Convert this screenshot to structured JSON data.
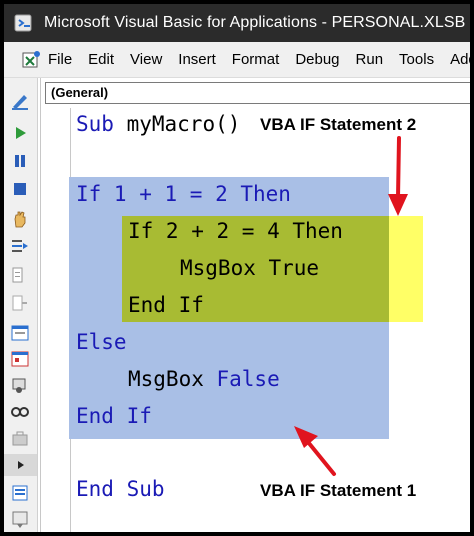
{
  "window": {
    "title": "Microsoft Visual Basic for Applications - PERSONAL.XLSB - [Module"
  },
  "menu": [
    "File",
    "Edit",
    "View",
    "Insert",
    "Format",
    "Debug",
    "Run",
    "Tools",
    "Add-I"
  ],
  "toolbar_icons": [
    "design-mode-icon",
    "run-icon",
    "pause-icon",
    "stop-icon",
    "hand-icon",
    "step-into-icon",
    "step-over-icon",
    "step-out-icon",
    "userform-icon",
    "properties-icon",
    "object-browser-icon",
    "watch-icon",
    "toolbox-icon",
    "expand-icon",
    "module-icon",
    "project-icon"
  ],
  "code_window": {
    "object_combo": "(General)",
    "lines": {
      "sub_keyword": "Sub",
      "sub_name": " myMacro()",
      "if1": "If 1 + 1 = 2 Then",
      "if2": "If 2 + 2 = 4 Then",
      "msgbox1_fn": "MsgBox",
      "msgbox1_val": " True",
      "endif2": "End If",
      "else": "Else",
      "msgbox2_fn": "MsgBox",
      "msgbox2_val": " False",
      "endif1": "End If",
      "endsub": "End Sub"
    }
  },
  "annotations": {
    "stmt2": "VBA IF Statement 2",
    "stmt1": "VBA IF Statement 1"
  },
  "colors": {
    "keyword": "#1a1ab5",
    "highlight_outer": "#a9bfe6",
    "highlight_inner": "#a8bb33",
    "highlight_yellow": "#ffff66",
    "arrow": "#e0141e"
  }
}
